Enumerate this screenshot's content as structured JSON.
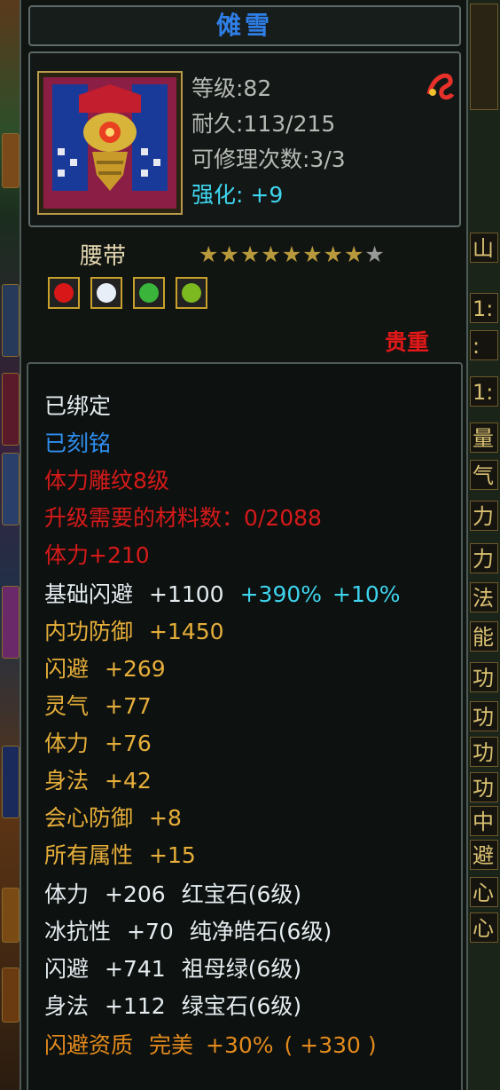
{
  "item": {
    "title": "傩雪",
    "stats": {
      "level": "等级:82",
      "durability": "耐久:113/215",
      "repairs": "可修理次数:3/3",
      "enhance": "强化: +9"
    },
    "type_label": "腰带",
    "stars_filled": 8,
    "stars_total": 9,
    "star_char": "★",
    "rarity": "贵重",
    "gems": [
      {
        "icon": "ruby-gem-icon",
        "color": "#d81818"
      },
      {
        "icon": "crystal-gem-icon",
        "color": "#e8eef8"
      },
      {
        "icon": "emerald-gem-icon",
        "color": "#3ab43a"
      },
      {
        "icon": "green-gem-icon",
        "color": "#7cb820"
      }
    ]
  },
  "attributes": {
    "bound": "已绑定",
    "engraved": "已刻铭",
    "carving": "体力雕纹8级",
    "upgrade_materials": "升级需要的材料数：0/2088",
    "carve_bonus": "体力+210",
    "base_dodge": {
      "label": "基础闪避",
      "value": "+1100",
      "extra1": "+390%",
      "extra2": "+10%"
    },
    "inner_defense": {
      "label": "内功防御",
      "value": "+1450"
    },
    "dodge": {
      "label": "闪避",
      "value": "+269"
    },
    "spirit": {
      "label": "灵气",
      "value": "+77"
    },
    "stamina": {
      "label": "体力",
      "value": "+76"
    },
    "agility": {
      "label": "身法",
      "value": "+42"
    },
    "crit_defense": {
      "label": "会心防御",
      "value": "+8"
    },
    "all_attr": {
      "label": "所有属性",
      "value": "+15"
    },
    "gem_lines": [
      {
        "label": "体力",
        "value": "+206",
        "gem": "红宝石(6级)"
      },
      {
        "label": "冰抗性",
        "value": "+70",
        "gem": "纯净皓石(6级)"
      },
      {
        "label": "闪避",
        "value": "+741",
        "gem": "祖母绿(6级)"
      },
      {
        "label": "身法",
        "value": "+112",
        "gem": "绿宝石(6级)"
      }
    ],
    "quality": {
      "label": "闪避资质",
      "grade": "完美",
      "value": "+30%",
      "extra": "( +330 )"
    }
  },
  "side_panel": [
    "山",
    "1:",
    ":",
    "1:",
    "量",
    "气",
    "力",
    "力",
    "法",
    "能",
    "功",
    "功",
    "功",
    "功",
    "中",
    "避",
    "心",
    "心"
  ]
}
